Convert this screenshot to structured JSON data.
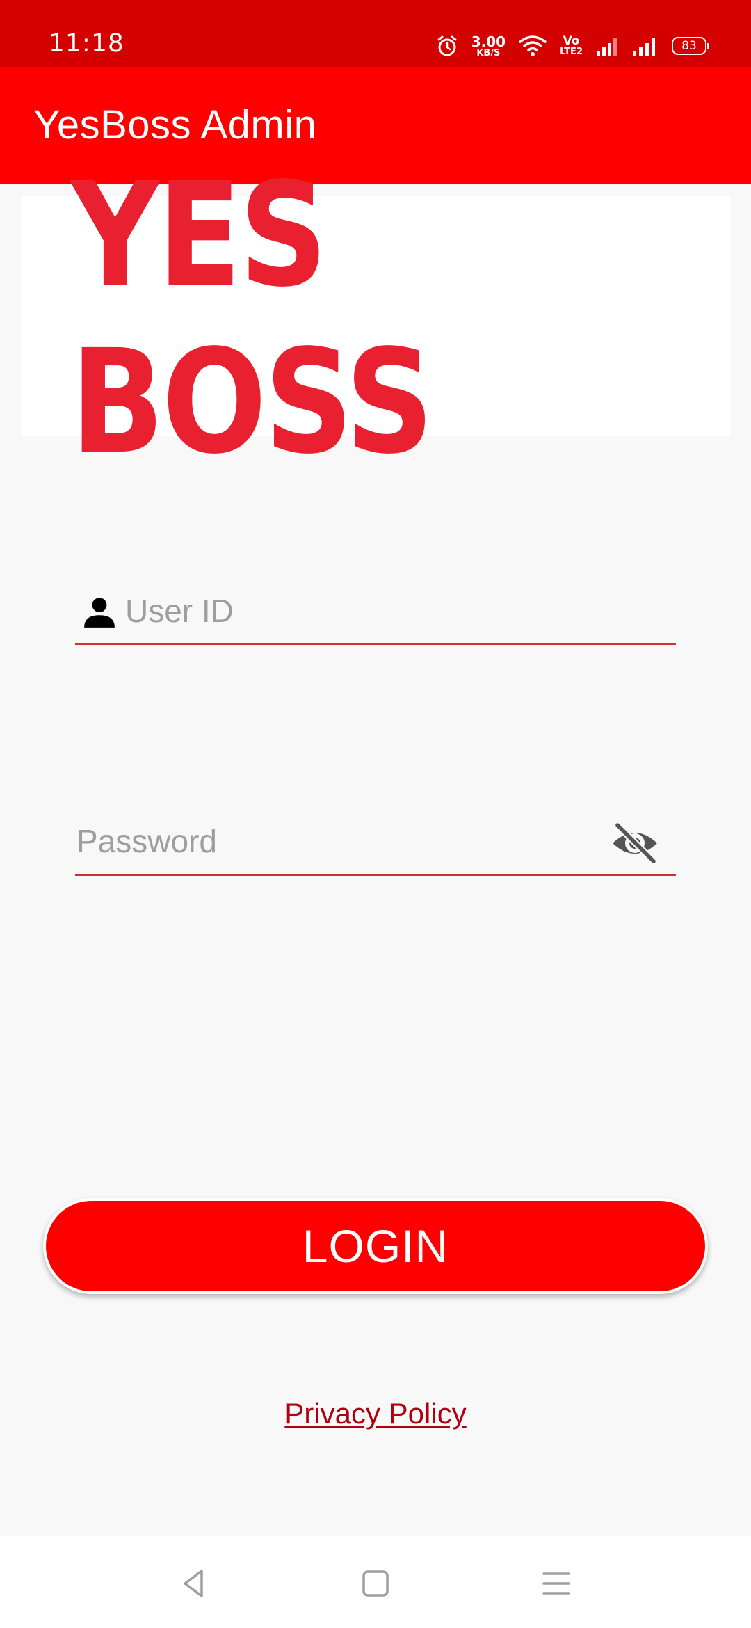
{
  "status_bar": {
    "time": "11:18",
    "net_speed_value": "3.00",
    "net_speed_unit": "KB/S",
    "volte_top": "Vo",
    "volte_bottom": "LTE2",
    "battery": "83",
    "icons": [
      "alarm-icon",
      "wifi-icon",
      "volte-icon",
      "signal-icon",
      "signal-icon",
      "battery-icon"
    ]
  },
  "app_bar": {
    "title": "YesBoss Admin"
  },
  "logo": {
    "text": "YES BOSS",
    "color": "#e8202f"
  },
  "form": {
    "user_id": {
      "placeholder": "User ID",
      "value": "",
      "icon": "person-icon"
    },
    "password": {
      "placeholder": "Password",
      "value": "",
      "icon": "eye-off-icon"
    },
    "login_label": "LOGIN",
    "privacy_label": "Privacy Policy"
  },
  "nav_bar": {
    "buttons": [
      "back-icon",
      "home-icon",
      "recents-icon"
    ]
  },
  "colors": {
    "status_bar": "#d50000",
    "app_bar": "#ff0000",
    "accent": "#d32f2f",
    "button": "#ff0000",
    "link": "#b00010",
    "background": "#f8f8f8"
  }
}
